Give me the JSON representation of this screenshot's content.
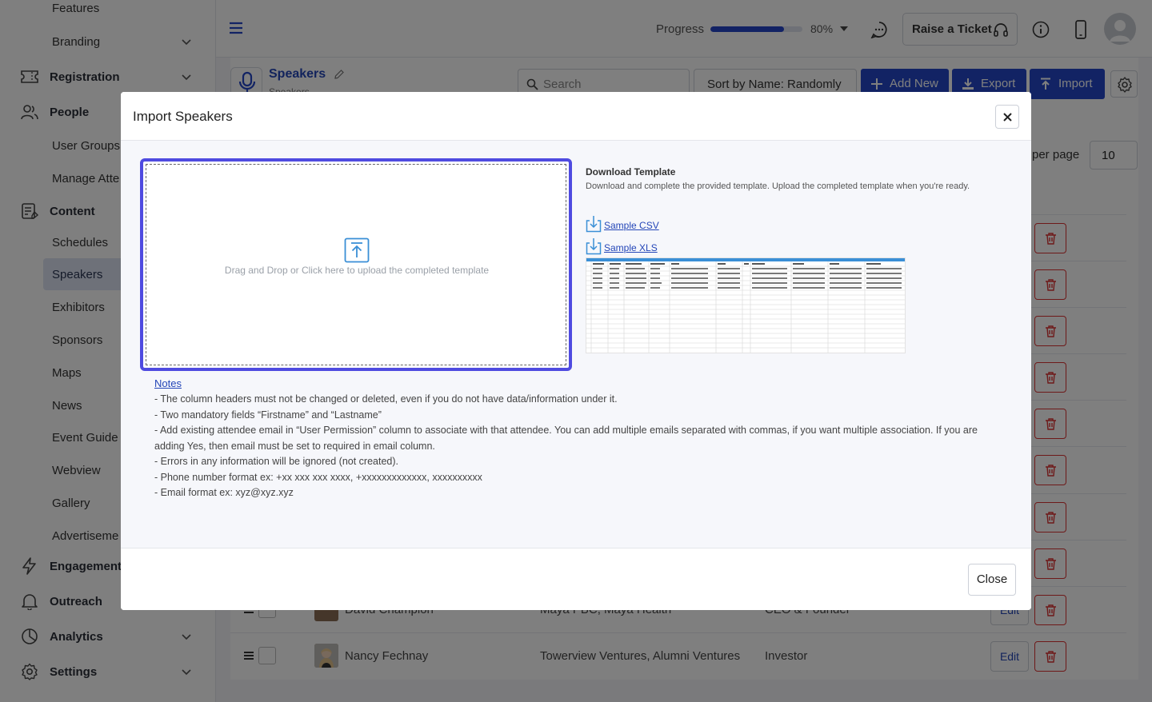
{
  "sidebar": {
    "items": [
      {
        "label": "Features",
        "type": "sub"
      },
      {
        "label": "Branding",
        "type": "sub",
        "chevron": true
      },
      {
        "label": "Registration",
        "type": "top",
        "icon": "ticket-icon",
        "chevron": true
      },
      {
        "label": "People",
        "type": "top",
        "icon": "people-icon"
      },
      {
        "label": "User Groups",
        "type": "sub"
      },
      {
        "label": "Manage Atte",
        "type": "sub"
      },
      {
        "label": "Content",
        "type": "top",
        "icon": "content-icon"
      },
      {
        "label": "Schedules",
        "type": "sub"
      },
      {
        "label": "Speakers",
        "type": "sub",
        "active": true
      },
      {
        "label": "Exhibitors",
        "type": "sub"
      },
      {
        "label": "Sponsors",
        "type": "sub"
      },
      {
        "label": "Maps",
        "type": "sub"
      },
      {
        "label": "News",
        "type": "sub"
      },
      {
        "label": "Event Guide",
        "type": "sub"
      },
      {
        "label": "Webview",
        "type": "sub"
      },
      {
        "label": "Gallery",
        "type": "sub"
      },
      {
        "label": "Advertiseme",
        "type": "sub"
      },
      {
        "label": "Engagement",
        "type": "top",
        "icon": "lightning-icon"
      },
      {
        "label": "Outreach",
        "type": "top",
        "icon": "bell-icon"
      },
      {
        "label": "Analytics",
        "type": "top",
        "icon": "pie-chart-icon",
        "chevron": true
      },
      {
        "label": "Settings",
        "type": "top",
        "icon": "gear-icon",
        "chevron": true
      }
    ]
  },
  "topbar": {
    "progress_label": "Progress",
    "progress_value": 0.8,
    "progress_pct": "80%",
    "ticket_label": "Raise a Ticket"
  },
  "page": {
    "title": "Speakers",
    "subtitle": "Speakers",
    "search_placeholder": "Search",
    "sort_value": "Sort by Name: Randomly",
    "add_new_label": "Add New",
    "export_label": "Export",
    "import_label": "Import",
    "per_page_label": "per page",
    "per_page_value": "10"
  },
  "table": {
    "rows": [
      {
        "name": "David Champion",
        "org": "Maya PBC, Maya Health",
        "title": "CEO & Founder",
        "edit": "Edit"
      },
      {
        "name": "Nancy Fechnay",
        "org": "Towerview Ventures, Alumni Ventures",
        "title": "Investor",
        "edit": "Edit"
      }
    ]
  },
  "modal": {
    "title": "Import Speakers",
    "dropzone_text": "Drag and Drop or Click here to upload the completed template",
    "download_title": "Download Template",
    "download_desc": "Download and complete the provided template. Upload the completed template when you're ready.",
    "sample_csv": "Sample CSV",
    "sample_xls": "Sample XLS",
    "notes_label": "Notes",
    "notes": [
      "- The column headers must not be changed or deleted, even if you do not have data/information under it.",
      "- Two mandatory fields “Firstname” and “Lastname”",
      "- Add existing attendee email in “User Permission” column to associate with that attendee. You can add multiple emails separated with commas, if you want multiple association. If you are adding Yes, then email must be set to required in email column.",
      "- Errors in any information will be ignored (not created).",
      "- Phone number format ex: +xx xxx xxx xxxx, +xxxxxxxxxxxxx, xxxxxxxxxx",
      "- Email format ex: xyz@xyz.xyz"
    ],
    "close_label": "Close"
  },
  "colors": {
    "brand_blue": "#2446c8",
    "dropzone_border": "#4f4be0",
    "danger": "#dd3333"
  }
}
